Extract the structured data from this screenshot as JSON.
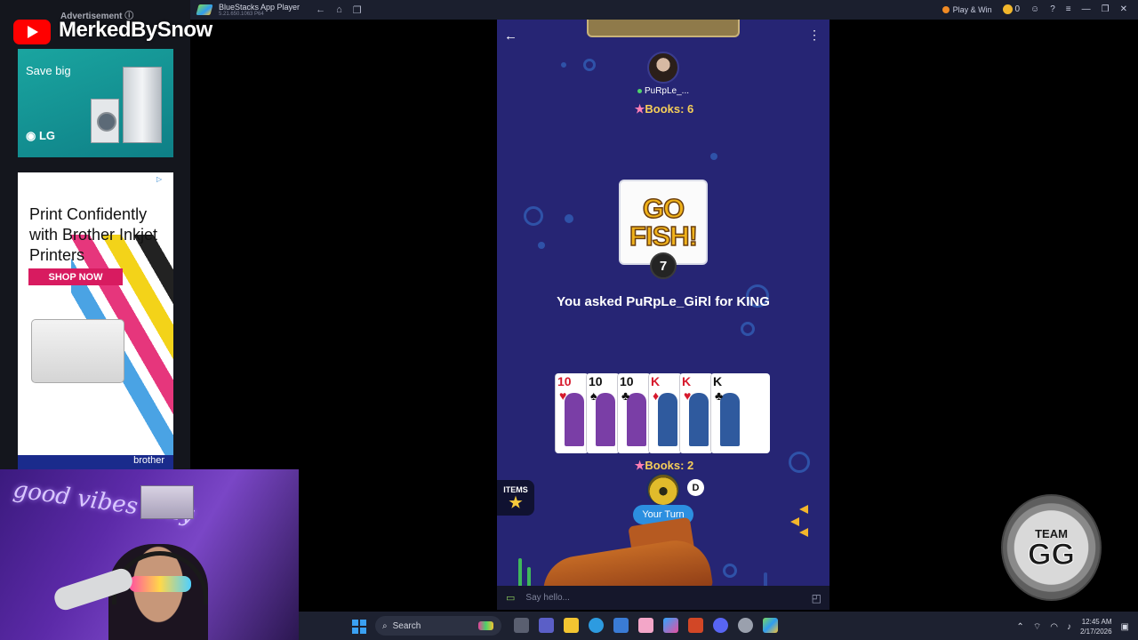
{
  "titlebar": {
    "app_title": "BlueStacks App Player",
    "subtitle": "5.21.650.1063 P64",
    "play_win": "Play & Win",
    "coins": "0",
    "nav": {
      "back": "←",
      "home": "⌂",
      "tabs": "❐"
    },
    "controls": {
      "help": "?",
      "menu": "≡",
      "minimize": "—",
      "restore": "❐",
      "close": "✕"
    }
  },
  "ads": {
    "label": "Advertisement ⓘ",
    "lg": {
      "tagline": "Save big",
      "brand": "LG"
    },
    "brother": {
      "headline": "Print Confidently with Brother Inkjet Printers",
      "cta": "SHOP NOW",
      "brand": "brother"
    }
  },
  "overlay": {
    "channel_name": "MerkedBySnow",
    "team_badge_top": "TEAM",
    "team_badge_main": "GG",
    "neon_text": "good vibes only"
  },
  "game": {
    "opponent": {
      "name": "PuRpLe_...",
      "books_label": "Books: 6"
    },
    "logo_line1": "GO",
    "logo_line2": "FISH!",
    "deck_count": "7",
    "status_message": "You asked PuRpLe_GiRl for KING",
    "hand": [
      {
        "rank": "10",
        "suit": "♥",
        "color": "#d6192c",
        "art": "#7a3ea6"
      },
      {
        "rank": "10",
        "suit": "♠",
        "color": "#111111",
        "art": "#7a3ea6"
      },
      {
        "rank": "10",
        "suit": "♣",
        "color": "#111111",
        "art": "#7a3ea6"
      },
      {
        "rank": "K",
        "suit": "♦",
        "color": "#d6192c",
        "art": "#2f5a9e"
      },
      {
        "rank": "K",
        "suit": "♥",
        "color": "#d6192c",
        "art": "#2f5a9e"
      },
      {
        "rank": "K",
        "suit": "♣",
        "color": "#111111",
        "art": "#2f5a9e"
      }
    ],
    "player": {
      "books_label": "Books: 2",
      "dealer_badge": "D",
      "turn_label": "Your Turn",
      "timer_fraction": 0.55
    },
    "items_label": "ITEMS",
    "chat_placeholder": "Say hello..."
  },
  "taskbar": {
    "search_label": "Search",
    "time": "12:45 AM",
    "date": "2/17/2026"
  },
  "colors": {
    "game_bg": "#262574",
    "accent_blue": "#2c8fe0",
    "books_gold": "#f6cf58",
    "youtube_red": "#ff0000"
  }
}
